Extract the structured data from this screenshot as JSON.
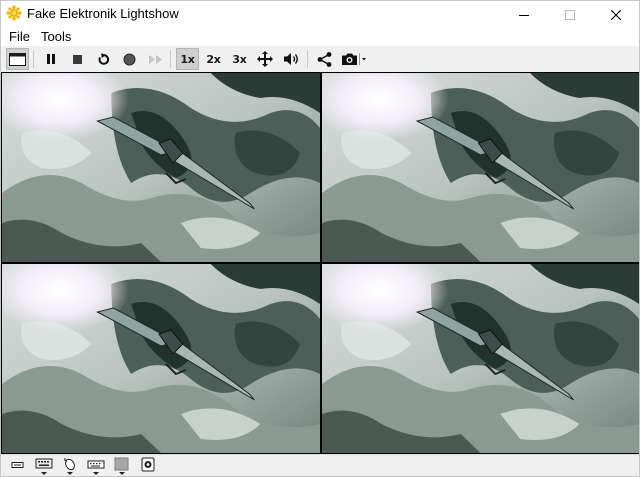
{
  "window": {
    "title": "Fake Elektronik Lightshow",
    "controls": [
      "minimize-button",
      "maximize-button",
      "close-button"
    ]
  },
  "menu": {
    "items": [
      {
        "label": "File"
      },
      {
        "label": "Tools"
      }
    ]
  },
  "toolbar": {
    "buttons": [
      {
        "icon": "fullscreen-icon",
        "active": true
      },
      {
        "icon": "pause-icon"
      },
      {
        "icon": "stop-icon"
      },
      {
        "icon": "restart-icon"
      },
      {
        "icon": "record-icon"
      },
      {
        "icon": "fast-forward-icon",
        "disabled": true
      },
      {
        "label": "1x",
        "active": true
      },
      {
        "label": "2x"
      },
      {
        "label": "3x"
      },
      {
        "icon": "move-icon"
      },
      {
        "icon": "volume-icon"
      },
      {
        "icon": "share-icon"
      },
      {
        "icon": "camera-icon"
      }
    ]
  },
  "video": {
    "panes": [
      "top-left",
      "top-right",
      "bottom-left",
      "bottom-right"
    ]
  },
  "statusbar": {
    "icons": [
      "drive-icon",
      "keyboard-icon",
      "mouse-icon",
      "keyboard-small-icon",
      "display-icon",
      "speaker-icon"
    ]
  },
  "colors": {
    "toolbar_bg": "#f0f0f0",
    "active_button": "#cfcfcf",
    "app_icon": "#f2b400"
  }
}
